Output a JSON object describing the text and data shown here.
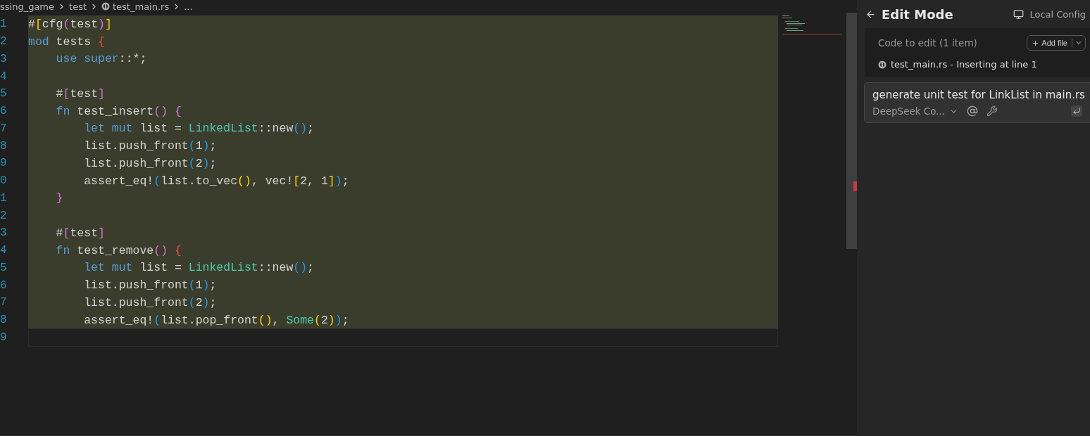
{
  "breadcrumb": [
    {
      "label": "ssing_game",
      "icon": false
    },
    {
      "label": "test",
      "icon": false
    },
    {
      "label": "test_main.rs",
      "icon": true
    },
    {
      "label": "...",
      "icon": false
    }
  ],
  "editor": {
    "lines": [
      {
        "number": "1",
        "highlighted": true,
        "tokens": [
          {
            "t": "#",
            "color": "#d4d4d4"
          },
          {
            "t": "[",
            "color": "#ffd700"
          },
          {
            "t": "cfg",
            "color": "#d4d4d4"
          },
          {
            "t": "(",
            "color": "#da70d6"
          },
          {
            "t": "test",
            "color": "#d4d4d4"
          },
          {
            "t": ")",
            "color": "#da70d6"
          },
          {
            "t": "]",
            "color": "#ffd700"
          }
        ]
      },
      {
        "number": "2",
        "highlighted": true,
        "tokens": [
          {
            "t": "mod",
            "color": "#569cd6"
          },
          {
            "t": " tests ",
            "color": "#d4d4d4"
          },
          {
            "t": "{",
            "color": "#f44747"
          }
        ]
      },
      {
        "number": "3",
        "highlighted": true,
        "tokens": [
          {
            "t": "    use super",
            "color": "#569cd6"
          },
          {
            "t": "::*;",
            "color": "#d4d4d4"
          }
        ]
      },
      {
        "number": "4",
        "highlighted": true
      },
      {
        "number": "5",
        "highlighted": true,
        "tokens": [
          {
            "t": "    #",
            "color": "#d4d4d4"
          },
          {
            "t": "[",
            "color": "#da70d6"
          },
          {
            "t": "test",
            "color": "#d4d4d4"
          },
          {
            "t": "]",
            "color": "#da70d6"
          }
        ]
      },
      {
        "number": "6",
        "highlighted": true,
        "tokens": [
          {
            "t": "    fn",
            "color": "#569cd6"
          },
          {
            "t": " test_insert",
            "color": "#d4d4d4"
          },
          {
            "t": "() {",
            "color": "#da70d6"
          }
        ]
      },
      {
        "number": "7",
        "highlighted": true,
        "tokens": [
          {
            "t": "        let mut",
            "color": "#569cd6"
          },
          {
            "t": " list = ",
            "color": "#d4d4d4"
          },
          {
            "t": "LinkedList",
            "color": "#4ec9b0"
          },
          {
            "t": "::new",
            "color": "#d4d4d4"
          },
          {
            "t": "()",
            "color": "#179fff"
          },
          {
            "t": ";",
            "color": "#d4d4d4"
          }
        ]
      },
      {
        "number": "8",
        "highlighted": true,
        "tokens": [
          {
            "t": "        list.push_front",
            "color": "#d4d4d4"
          },
          {
            "t": "(",
            "color": "#179fff"
          },
          {
            "t": "1",
            "color": "#d4d4d4"
          },
          {
            "t": ")",
            "color": "#179fff"
          },
          {
            "t": ";",
            "color": "#d4d4d4"
          }
        ]
      },
      {
        "number": "9",
        "highlighted": true,
        "tokens": [
          {
            "t": "        list.push_front",
            "color": "#d4d4d4"
          },
          {
            "t": "(",
            "color": "#179fff"
          },
          {
            "t": "2",
            "color": "#d4d4d4"
          },
          {
            "t": ")",
            "color": "#179fff"
          },
          {
            "t": ";",
            "color": "#d4d4d4"
          }
        ]
      },
      {
        "number": "0",
        "highlighted": true,
        "tokens": [
          {
            "t": "        assert_eq!",
            "color": "#d4d4d4"
          },
          {
            "t": "(",
            "color": "#179fff"
          },
          {
            "t": "list.to_vec",
            "color": "#d4d4d4"
          },
          {
            "t": "()",
            "color": "#ffd700"
          },
          {
            "t": ", vec!",
            "color": "#d4d4d4"
          },
          {
            "t": "[",
            "color": "#ffd700"
          },
          {
            "t": "2, 1",
            "color": "#d4d4d4"
          },
          {
            "t": "]",
            "color": "#ffd700"
          },
          {
            "t": ")",
            "color": "#179fff"
          },
          {
            "t": ";",
            "color": "#d4d4d4"
          }
        ]
      },
      {
        "number": "1",
        "highlighted": true,
        "tokens": [
          {
            "t": "    }",
            "color": "#da70d6"
          }
        ]
      },
      {
        "number": "2",
        "highlighted": true
      },
      {
        "number": "3",
        "highlighted": true,
        "tokens": [
          {
            "t": "    #",
            "color": "#d4d4d4"
          },
          {
            "t": "[",
            "color": "#da70d6"
          },
          {
            "t": "test",
            "color": "#d4d4d4"
          },
          {
            "t": "]",
            "color": "#da70d6"
          }
        ]
      },
      {
        "number": "4",
        "highlighted": true,
        "tokens": [
          {
            "t": "    fn",
            "color": "#569cd6"
          },
          {
            "t": " test_remove",
            "color": "#d4d4d4"
          },
          {
            "t": "()",
            "color": "#da70d6"
          },
          {
            "t": " {",
            "color": "#f44747"
          }
        ]
      },
      {
        "number": "5",
        "highlighted": true,
        "tokens": [
          {
            "t": "        let mut",
            "color": "#569cd6"
          },
          {
            "t": " list = ",
            "color": "#d4d4d4"
          },
          {
            "t": "LinkedList",
            "color": "#4ec9b0"
          },
          {
            "t": "::new",
            "color": "#d4d4d4"
          },
          {
            "t": "()",
            "color": "#179fff"
          },
          {
            "t": ";",
            "color": "#d4d4d4"
          }
        ]
      },
      {
        "number": "6",
        "highlighted": true,
        "tokens": [
          {
            "t": "        list.push_front",
            "color": "#d4d4d4"
          },
          {
            "t": "(",
            "color": "#179fff"
          },
          {
            "t": "1",
            "color": "#d4d4d4"
          },
          {
            "t": ")",
            "color": "#179fff"
          },
          {
            "t": ";",
            "color": "#d4d4d4"
          }
        ]
      },
      {
        "number": "7",
        "highlighted": true,
        "tokens": [
          {
            "t": "        list.push_front",
            "color": "#d4d4d4"
          },
          {
            "t": "(",
            "color": "#179fff"
          },
          {
            "t": "2",
            "color": "#d4d4d4"
          },
          {
            "t": ")",
            "color": "#179fff"
          },
          {
            "t": ";",
            "color": "#d4d4d4"
          }
        ]
      },
      {
        "number": "8",
        "highlighted": true,
        "tokens": [
          {
            "t": "        assert_eq!",
            "color": "#d4d4d4"
          },
          {
            "t": "(",
            "color": "#179fff"
          },
          {
            "t": "list.pop_front",
            "color": "#d4d4d4"
          },
          {
            "t": "()",
            "color": "#ffd700"
          },
          {
            "t": ", ",
            "color": "#d4d4d4"
          },
          {
            "t": "Some",
            "color": "#4ec9b0"
          },
          {
            "t": "(",
            "color": "#ffd700"
          },
          {
            "t": "2",
            "color": "#d4d4d4"
          },
          {
            "t": ")",
            "color": "#ffd700"
          },
          {
            "t": ")",
            "color": "#179fff"
          },
          {
            "t": ";",
            "color": "#d4d4d4"
          }
        ]
      },
      {
        "number": "9",
        "highlighted": false
      }
    ]
  },
  "panel": {
    "title": "Edit Mode",
    "config": "Local Config",
    "section_label": "Code to edit (1 item)",
    "add_button": "Add file",
    "file_item": "test_main.rs - Inserting at line 1",
    "prompt": {
      "value": "generate unit test for LinkList in main.rs",
      "model": "DeepSeek Co..."
    }
  }
}
